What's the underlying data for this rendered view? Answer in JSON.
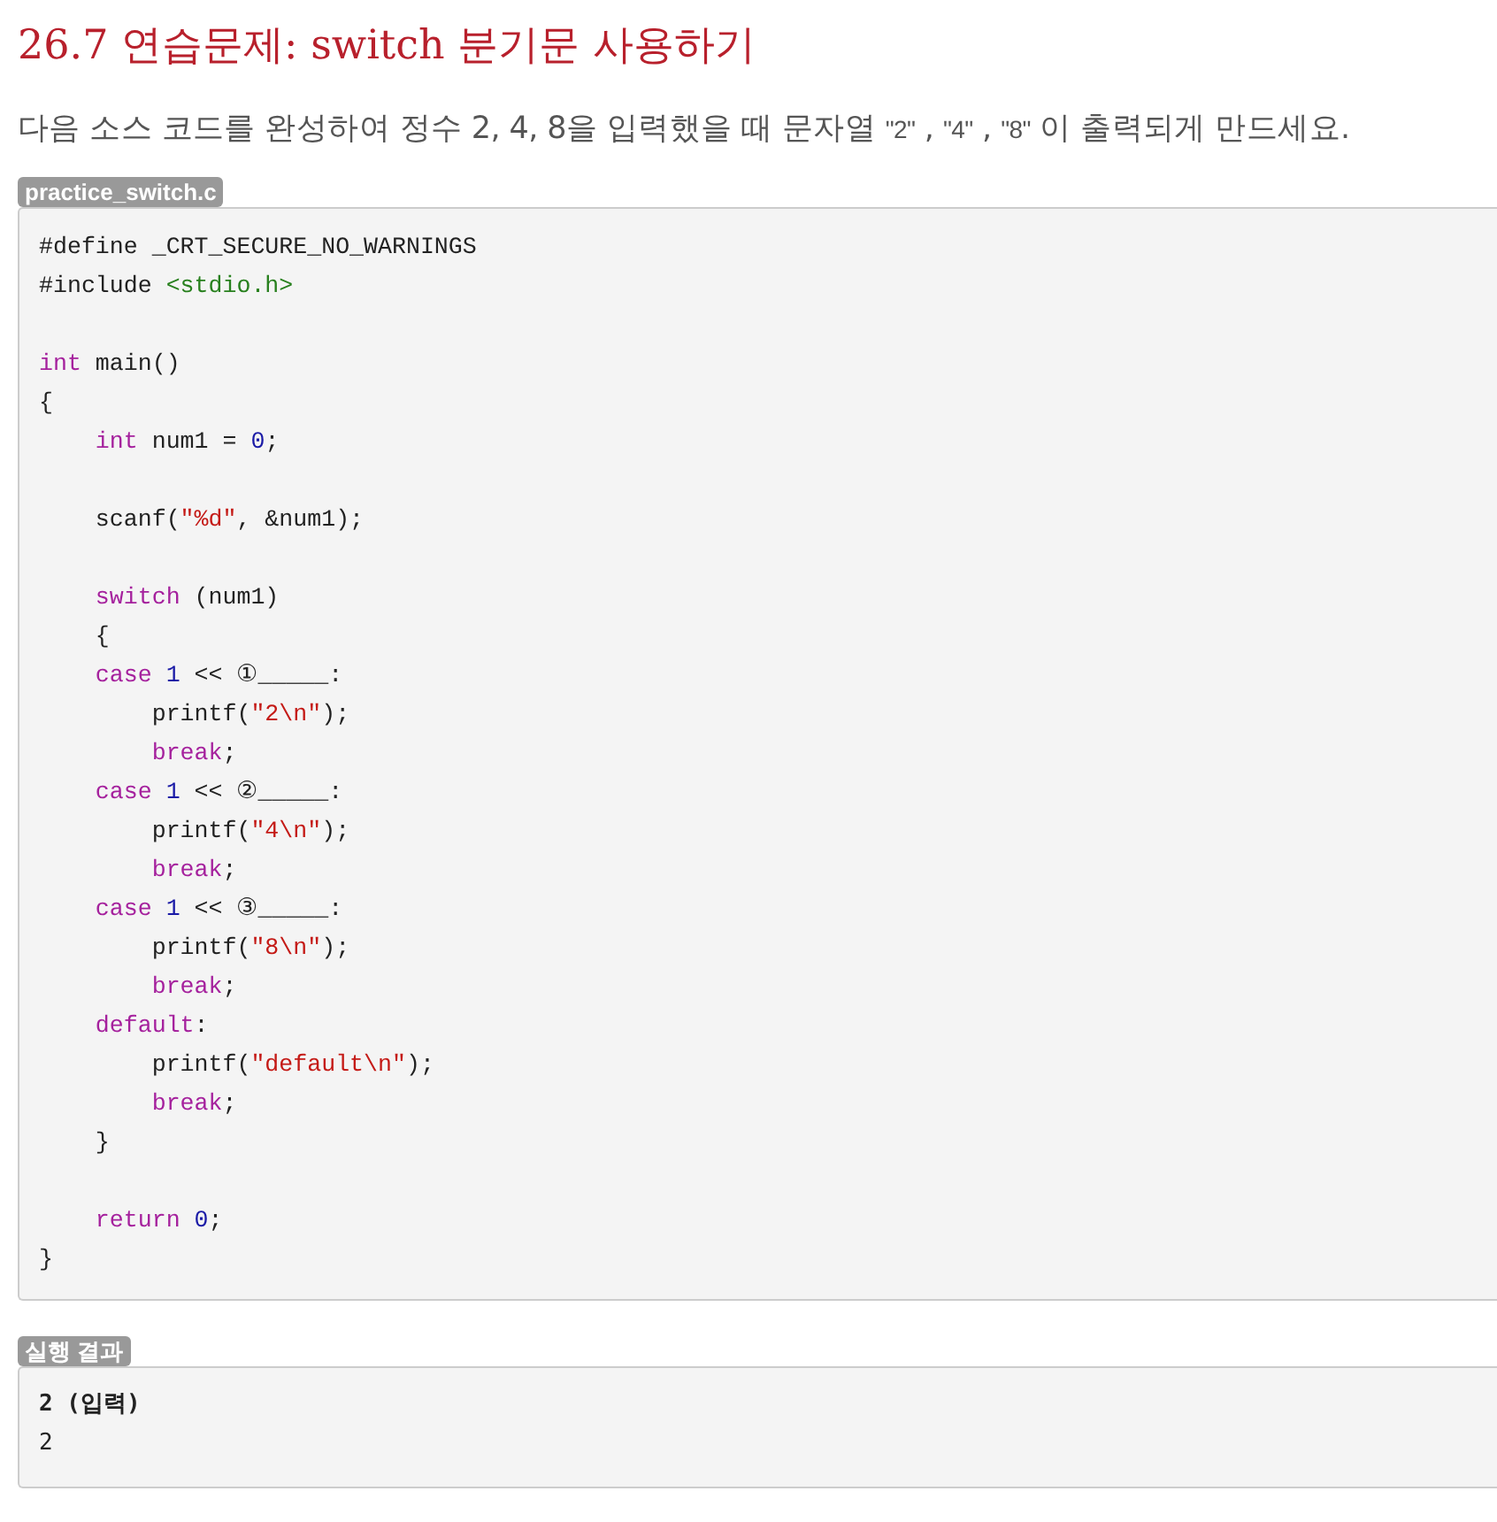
{
  "title": "26.7 연습문제: switch 분기문 사용하기",
  "description": [
    {
      "kind": "text",
      "text": "다음 소스 코드를 완성하여 정수 2, 4, 8을 입력했을 때 문자열 "
    },
    {
      "kind": "code",
      "text": "\"2\""
    },
    {
      "kind": "text",
      "text": " , "
    },
    {
      "kind": "code",
      "text": "\"4\""
    },
    {
      "kind": "text",
      "text": " , "
    },
    {
      "kind": "code",
      "text": "\"8\""
    },
    {
      "kind": "text",
      "text": " 이 출력되게 만드세요."
    }
  ],
  "code_block": {
    "label": "practice_switch.c",
    "lines": [
      {
        "kind": "code",
        "tokens": [
          {
            "kind": "plain",
            "text": "#define _CRT_SECURE_NO_WARNINGS"
          }
        ]
      },
      {
        "kind": "code",
        "tokens": [
          {
            "kind": "plain",
            "text": "#include "
          },
          {
            "kind": "include",
            "text": "<stdio.h>"
          }
        ]
      },
      {
        "kind": "blank"
      },
      {
        "kind": "code",
        "tokens": [
          {
            "kind": "keyword",
            "text": "int"
          },
          {
            "kind": "plain",
            "text": " main()"
          }
        ]
      },
      {
        "kind": "code",
        "tokens": [
          {
            "kind": "plain",
            "text": "{"
          }
        ]
      },
      {
        "kind": "code",
        "tokens": [
          {
            "kind": "keyword",
            "text": "    int"
          },
          {
            "kind": "plain",
            "text": " num1 = "
          },
          {
            "kind": "number",
            "text": "0"
          },
          {
            "kind": "plain",
            "text": ";"
          }
        ]
      },
      {
        "kind": "blank"
      },
      {
        "kind": "code",
        "tokens": [
          {
            "kind": "plain",
            "text": "    scanf("
          },
          {
            "kind": "string",
            "text": "\"%d\""
          },
          {
            "kind": "plain",
            "text": ", &num1);"
          }
        ]
      },
      {
        "kind": "blank"
      },
      {
        "kind": "code",
        "tokens": [
          {
            "kind": "keyword",
            "text": "    switch"
          },
          {
            "kind": "plain",
            "text": " (num1)"
          }
        ]
      },
      {
        "kind": "code",
        "tokens": [
          {
            "kind": "plain",
            "text": "    {"
          }
        ]
      },
      {
        "kind": "code",
        "tokens": [
          {
            "kind": "keyword",
            "text": "    case "
          },
          {
            "kind": "number",
            "text": "1"
          },
          {
            "kind": "plain",
            "text": " << ①_____:"
          }
        ]
      },
      {
        "kind": "code",
        "tokens": [
          {
            "kind": "plain",
            "text": "        printf("
          },
          {
            "kind": "string",
            "text": "\"2\\n\""
          },
          {
            "kind": "plain",
            "text": ");"
          }
        ]
      },
      {
        "kind": "code",
        "tokens": [
          {
            "kind": "keyword",
            "text": "        break"
          },
          {
            "kind": "plain",
            "text": ";"
          }
        ]
      },
      {
        "kind": "code",
        "tokens": [
          {
            "kind": "keyword",
            "text": "    case "
          },
          {
            "kind": "number",
            "text": "1"
          },
          {
            "kind": "plain",
            "text": " << ②_____:"
          }
        ]
      },
      {
        "kind": "code",
        "tokens": [
          {
            "kind": "plain",
            "text": "        printf("
          },
          {
            "kind": "string",
            "text": "\"4\\n\""
          },
          {
            "kind": "plain",
            "text": ");"
          }
        ]
      },
      {
        "kind": "code",
        "tokens": [
          {
            "kind": "keyword",
            "text": "        break"
          },
          {
            "kind": "plain",
            "text": ";"
          }
        ]
      },
      {
        "kind": "code",
        "tokens": [
          {
            "kind": "keyword",
            "text": "    case "
          },
          {
            "kind": "number",
            "text": "1"
          },
          {
            "kind": "plain",
            "text": " << ③_____:"
          }
        ]
      },
      {
        "kind": "code",
        "tokens": [
          {
            "kind": "plain",
            "text": "        printf("
          },
          {
            "kind": "string",
            "text": "\"8\\n\""
          },
          {
            "kind": "plain",
            "text": ");"
          }
        ]
      },
      {
        "kind": "code",
        "tokens": [
          {
            "kind": "keyword",
            "text": "        break"
          },
          {
            "kind": "plain",
            "text": ";"
          }
        ]
      },
      {
        "kind": "code",
        "tokens": [
          {
            "kind": "keyword",
            "text": "    default"
          },
          {
            "kind": "plain",
            "text": ":"
          }
        ]
      },
      {
        "kind": "code",
        "tokens": [
          {
            "kind": "plain",
            "text": "        printf("
          },
          {
            "kind": "string",
            "text": "\"default\\n\""
          },
          {
            "kind": "plain",
            "text": ");"
          }
        ]
      },
      {
        "kind": "code",
        "tokens": [
          {
            "kind": "keyword",
            "text": "        break"
          },
          {
            "kind": "plain",
            "text": ";"
          }
        ]
      },
      {
        "kind": "code",
        "tokens": [
          {
            "kind": "plain",
            "text": "    }"
          }
        ]
      },
      {
        "kind": "blank"
      },
      {
        "kind": "code",
        "tokens": [
          {
            "kind": "keyword",
            "text": "    return "
          },
          {
            "kind": "number",
            "text": "0"
          },
          {
            "kind": "plain",
            "text": ";"
          }
        ]
      },
      {
        "kind": "code",
        "tokens": [
          {
            "kind": "plain",
            "text": "}"
          }
        ]
      }
    ]
  },
  "output_block": {
    "label": "실행 결과",
    "lines": [
      {
        "kind": "input",
        "text": "2 (입력)"
      },
      {
        "kind": "output",
        "text": "2"
      }
    ]
  }
}
